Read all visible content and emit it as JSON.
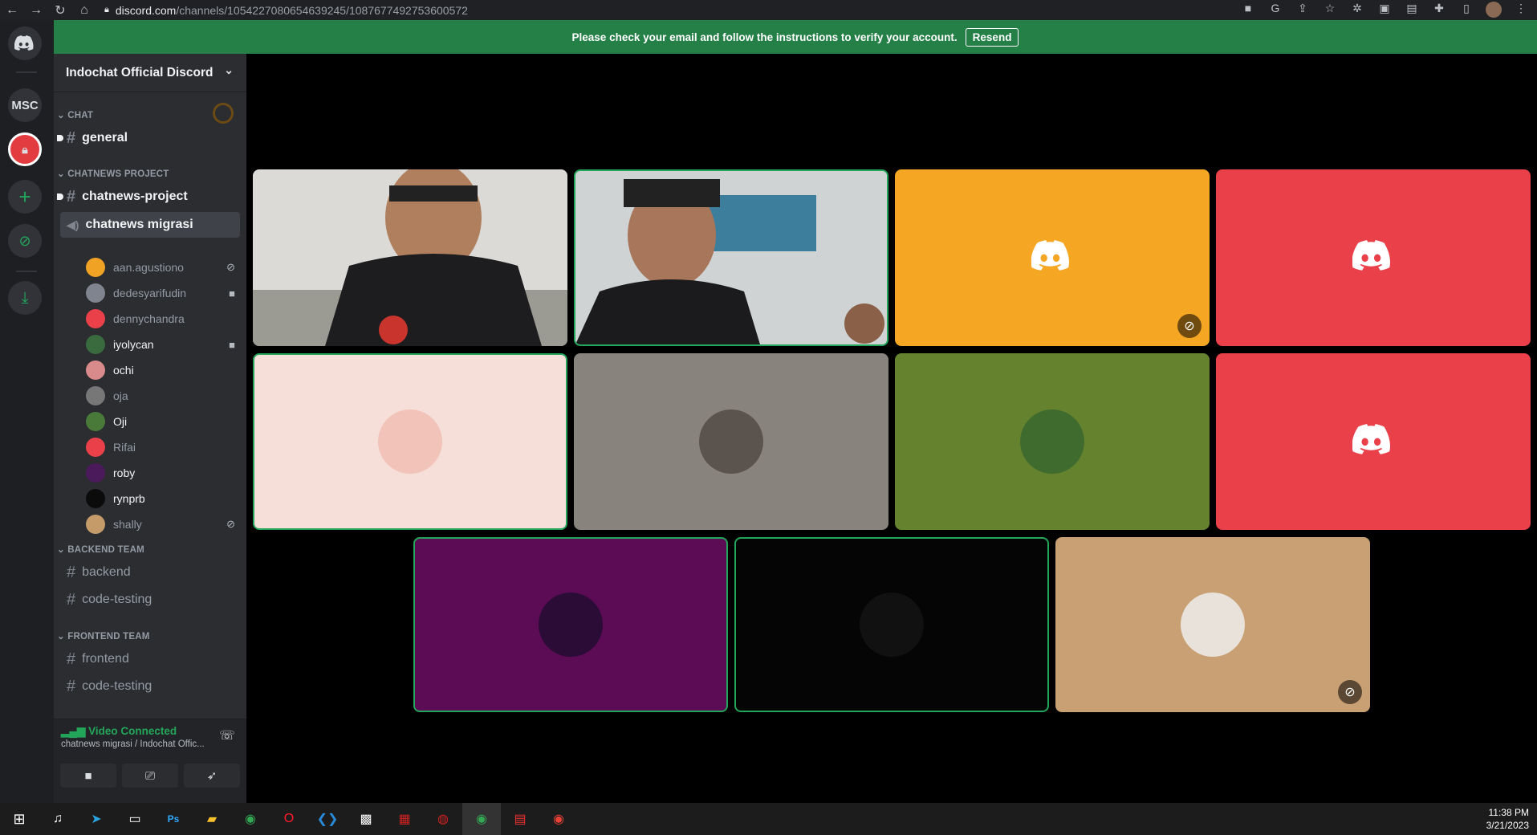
{
  "browser": {
    "url_domain": "discord.com",
    "url_path": "/channels/1054227080654639245/1087677492753600572"
  },
  "banner": {
    "text": "Please check your email and follow the instructions to verify your account.",
    "button": "Resend"
  },
  "guilds": [
    {
      "label": "MSC"
    }
  ],
  "server": {
    "name": "Indochat Official Discord"
  },
  "categories": {
    "chat": "CHAT",
    "chatnews": "CHATNEWS PROJECT",
    "backend": "BACKEND TEAM",
    "frontend": "FRONTEND TEAM"
  },
  "channels": {
    "general": "general",
    "chatnews_project": "chatnews-project",
    "chatnews_migrasi": "chatnews migrasi",
    "backend": "backend",
    "backend_code": "code-testing",
    "frontend": "frontend",
    "frontend_code": "code-testing"
  },
  "voice_users": [
    {
      "name": "aan.agustiono",
      "color": "#f0a225",
      "icon": "mute-icon"
    },
    {
      "name": "dedesyarifudin",
      "color": "#80848e",
      "icon": "camera-icon"
    },
    {
      "name": "dennychandra",
      "color": "#e9404a",
      "icon": ""
    },
    {
      "name": "iyolycan",
      "color": "#3a6b3f",
      "icon": "camera-icon"
    },
    {
      "name": "ochi",
      "color": "#d98b8b",
      "icon": ""
    },
    {
      "name": "oja",
      "color": "#777",
      "icon": ""
    },
    {
      "name": "Oji",
      "color": "#4a7a3a",
      "icon": ""
    },
    {
      "name": "Rifai",
      "color": "#e9404a",
      "icon": ""
    },
    {
      "name": "roby",
      "color": "#4b1a5a",
      "icon": ""
    },
    {
      "name": "rynprb",
      "color": "#0b0b0b",
      "icon": ""
    },
    {
      "name": "shally",
      "color": "#c59b6a",
      "icon": "mute-icon"
    }
  ],
  "voice_status": {
    "title": "Video Connected",
    "subtitle": "chatnews migrasi / Indochat Offic..."
  },
  "tiles_colors": [
    "#f5a623",
    "#e9404a",
    "#f6dfd9",
    "#88837d",
    "#65832f",
    "#e9404a",
    "#5c0b55",
    "#050505",
    "#c8a073"
  ],
  "clock": {
    "time": "11:38 PM",
    "date": "3/21/2023"
  }
}
